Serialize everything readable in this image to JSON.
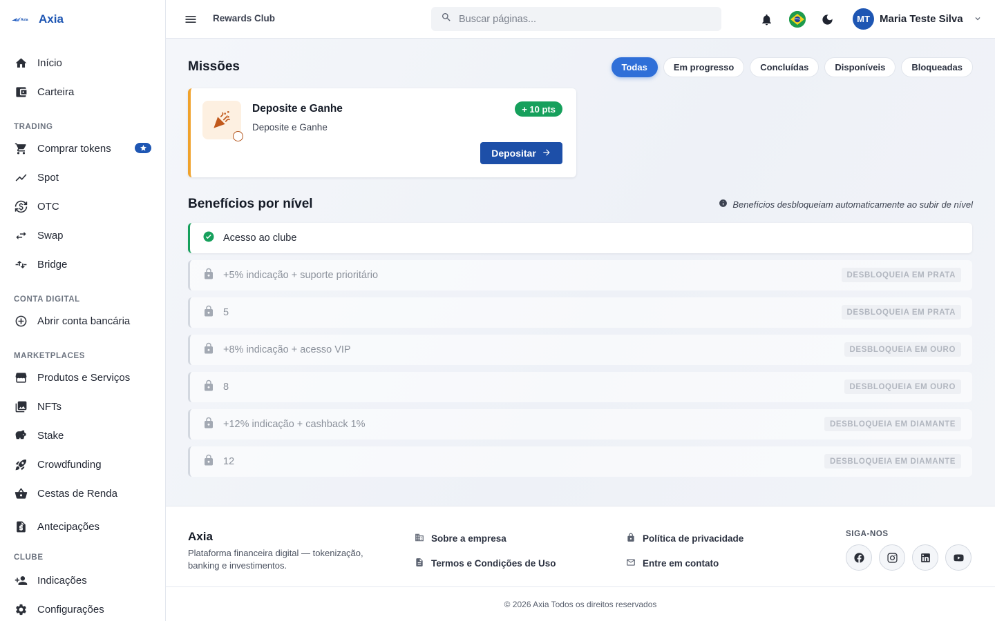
{
  "brand": {
    "logo_text": "Axia",
    "name": "Axia"
  },
  "sidebar": {
    "items": [
      {
        "label": "Início",
        "icon": "home-icon"
      },
      {
        "label": "Carteira",
        "icon": "wallet-icon"
      }
    ],
    "sections": [
      {
        "title": "TRADING",
        "items": [
          {
            "label": "Comprar tokens",
            "icon": "cart-icon",
            "badge": "star-icon"
          },
          {
            "label": "Spot",
            "icon": "trend-icon"
          },
          {
            "label": "OTC",
            "icon": "currency-exchange-icon"
          },
          {
            "label": "Swap",
            "icon": "swap-icon"
          },
          {
            "label": "Bridge",
            "icon": "bridge-icon"
          }
        ]
      },
      {
        "title": "CONTA DIGITAL",
        "items": [
          {
            "label": "Abrir conta bancária",
            "icon": "add-circle-icon"
          }
        ]
      },
      {
        "title": "MARKETPLACES",
        "items": [
          {
            "label": "Produtos e Serviços",
            "icon": "store-icon"
          },
          {
            "label": "NFTs",
            "icon": "image-collection-icon"
          },
          {
            "label": "Stake",
            "icon": "piggy-bank-icon"
          },
          {
            "label": "Crowdfunding",
            "icon": "rocket-icon"
          },
          {
            "label": "Cestas de Renda",
            "icon": "basket-icon"
          }
        ]
      },
      {
        "title": "",
        "items": [
          {
            "label": "Antecipações",
            "icon": "document-dollar-icon"
          }
        ]
      },
      {
        "title": "CLUBE",
        "items": [
          {
            "label": "Indicações",
            "icon": "person-add-icon"
          },
          {
            "label": "Configurações",
            "icon": "gear-icon"
          }
        ]
      }
    ]
  },
  "header": {
    "breadcrumb": "Rewards Club",
    "search_placeholder": "Buscar páginas...",
    "user": {
      "initials": "MT",
      "name": "Maria Teste Silva"
    }
  },
  "missions": {
    "title": "Missões",
    "filters": [
      "Todas",
      "Em progresso",
      "Concluídas",
      "Disponíveis",
      "Bloqueadas"
    ],
    "active_filter": "Todas",
    "card": {
      "title": "Deposite e Ganhe",
      "subtitle": "Deposite e Ganhe",
      "points": "+ 10 pts",
      "action": "Depositar",
      "accent": "#f0a22b"
    }
  },
  "benefits": {
    "title": "Benefícios por nível",
    "note": "Benefícios desbloqueiam automaticamente ao subir de nível",
    "unlocked": [
      {
        "label": "Acesso ao clube"
      }
    ],
    "locked": [
      {
        "label": "+5% indicação + suporte prioritário",
        "badge": "DESBLOQUEIA EM PRATA"
      },
      {
        "label": "5",
        "badge": "DESBLOQUEIA EM PRATA"
      },
      {
        "label": "+8% indicação + acesso VIP",
        "badge": "DESBLOQUEIA EM OURO"
      },
      {
        "label": "8",
        "badge": "DESBLOQUEIA EM OURO"
      },
      {
        "label": "+12% indicação + cashback 1%",
        "badge": "DESBLOQUEIA EM DIAMANTE"
      },
      {
        "label": "12",
        "badge": "DESBLOQUEIA EM DIAMANTE"
      }
    ]
  },
  "footer": {
    "brand": "Axia",
    "description": "Plataforma financeira digital — tokenização, banking e investimentos.",
    "links": {
      "about": "Sobre a empresa",
      "terms": "Termos e Condições de Uso",
      "privacy": "Política de privacidade",
      "contact": "Entre em contato"
    },
    "follow_title": "SIGA-NOS",
    "socials": [
      "facebook-icon",
      "instagram-icon",
      "linkedin-icon",
      "youtube-icon"
    ],
    "copyright": "© 2026 Axia Todos os direitos reservados"
  },
  "colors": {
    "primary": "#1e56b3",
    "success": "#16a05c",
    "accent": "#f0a22b"
  }
}
